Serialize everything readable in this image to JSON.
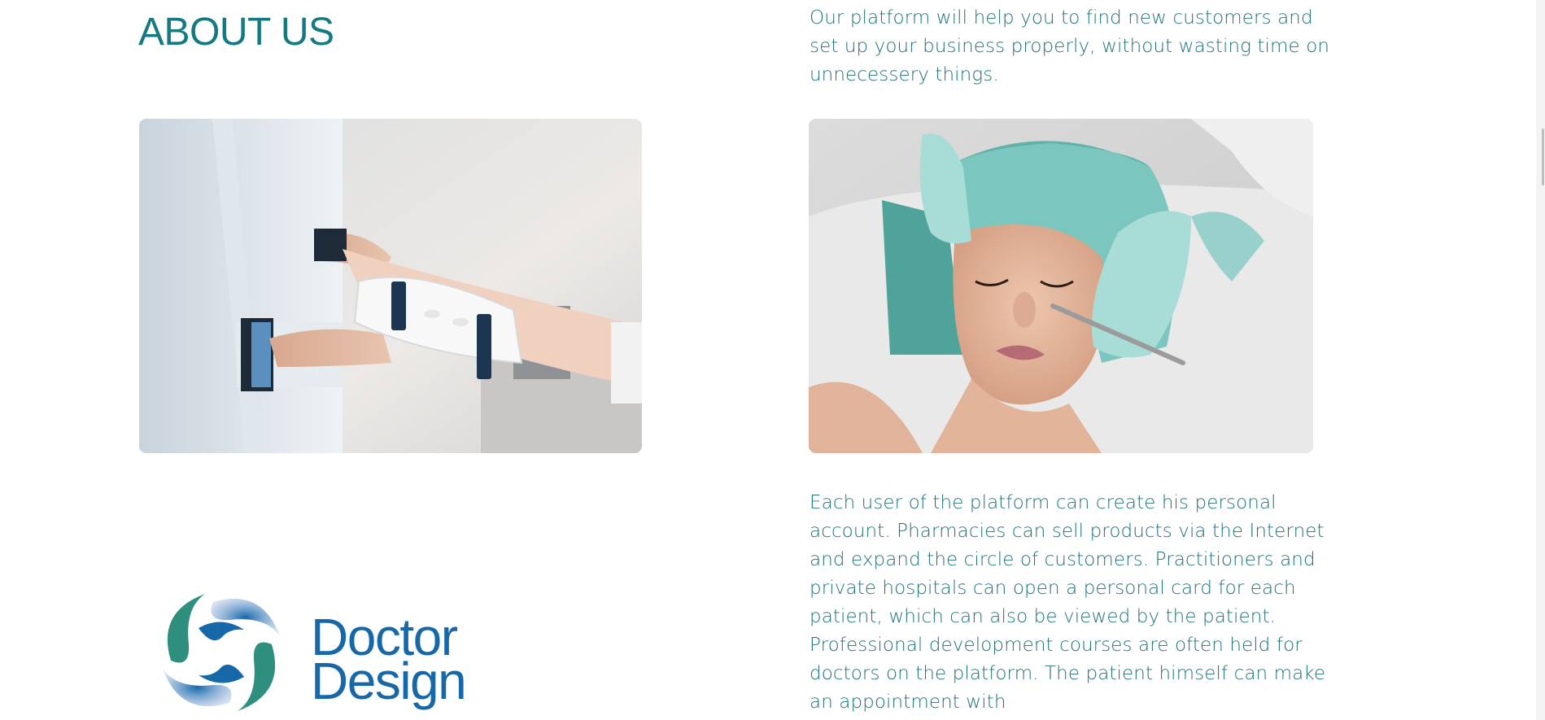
{
  "about": {
    "heading": "ABOUT US",
    "intro": "Our platform will help you to find new customers and set up your business properly, without wasting time on unnecessery things.",
    "details": "Each user of the platform can create his personal account. Pharmacies can sell products via the Internet and expand the circle of customers. Practitioners and private hospitals can open a personal card for each patient, which can also be viewed by the patient. Professional development courses are often held for doctors on the platform. The patient himself can make an appointment with"
  },
  "logo": {
    "line1": "Doctor",
    "line2": "Design"
  },
  "colors": {
    "accent": "#137a82",
    "logo_blue": "#1668a8",
    "logo_green": "#2f8f7e"
  }
}
